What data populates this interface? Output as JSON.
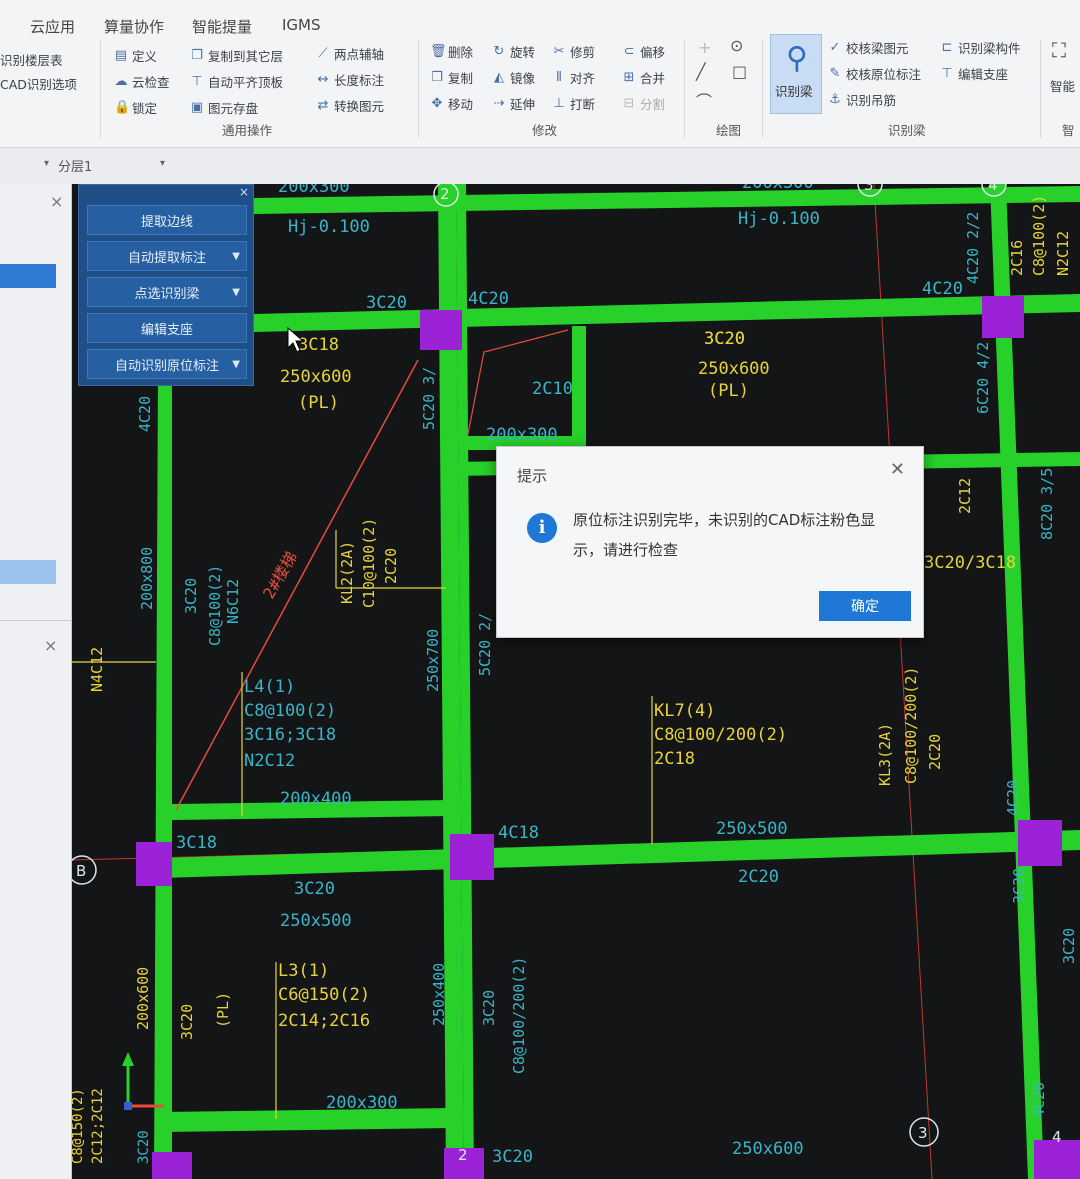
{
  "ribbon": {
    "tabs": [
      "云应用",
      "算量协作",
      "智能提量",
      "IGMS"
    ],
    "left_items": [
      "识别楼层表",
      "CAD识别选项"
    ],
    "general_ops": {
      "col1": [
        "定义",
        "云检查",
        "锁定"
      ],
      "col2": [
        "复制到其它层",
        "自动平齐顶板",
        "图元存盘"
      ],
      "col3": [
        "两点辅轴",
        "长度标注",
        "转换图元"
      ],
      "label": "通用操作"
    },
    "modify": {
      "col1": [
        "删除",
        "复制",
        "移动"
      ],
      "col2": [
        "旋转",
        "镜像",
        "延伸"
      ],
      "col3": [
        "修剪",
        "对齐",
        "打断"
      ],
      "col4": [
        "偏移",
        "合并",
        "分割"
      ],
      "label": "修改"
    },
    "draw_label": "绘图",
    "identify_beam": {
      "big_button": "识别梁",
      "items": [
        "校核梁图元",
        "校核原位标注",
        "识别吊筋",
        "识别梁构件",
        "编辑支座"
      ],
      "label": "识别梁"
    },
    "right_partial": [
      "智能",
      "智"
    ]
  },
  "subbar": {
    "layer": "分层1"
  },
  "toolpanel": {
    "buttons": [
      "提取边线",
      "自动提取标注",
      "点选识别梁",
      "编辑支座",
      "自动识别原位标注"
    ]
  },
  "dialog": {
    "title": "提示",
    "message": "原位标注识别完毕，未识别的CAD标注粉色显示，请进行检查",
    "ok": "确定"
  },
  "cad": {
    "axis_labels": [
      "2",
      "3",
      "4",
      "B",
      "2",
      "3",
      "4"
    ],
    "annotations": [
      "200x300",
      "Hj-0.100",
      "Hj-0.100",
      "200x300",
      "3C20",
      "4C20",
      "3C20",
      "4C20",
      "3C18",
      "250x600",
      "(PL)",
      "3C20",
      "250x600",
      "(PL)",
      "2C10",
      "200x300",
      "4C20",
      "200x800",
      "3C20",
      "C8@100(2)",
      "N6C12",
      "2#楼梯",
      "KL2(2A)",
      "C10@100(2)",
      "2C20",
      "250x700",
      "5C20 3/",
      "5C20 2/",
      "L4(1)",
      "C8@100(2)",
      "3C16;3C18",
      "N2C12",
      "200x400",
      "3C18",
      "4C18",
      "KL7(4)",
      "C8@100/200(2)",
      "2C18",
      "250x500",
      "2C20",
      "KL3(2A)",
      "C8@100/200(2)",
      "2C20",
      "4C20",
      "3C20",
      "3C20/3C18",
      "2C12",
      "6C20 4/2",
      "8C20 3/5",
      "4C20 2/2",
      "2C16",
      "C8@100(2)",
      "N2C12",
      "3C20",
      "250x500",
      "L3(1)",
      "C6@150(2)",
      "2C14;2C16",
      "(PL)",
      "200x600",
      "3C20",
      "250x400",
      "3C20",
      "C8@100/200(2)",
      "200x300",
      "N4C12",
      "C8@150(2)",
      "2C12;2C12",
      "3C20",
      "3C20",
      "250x600",
      "4C20",
      "3C20"
    ]
  }
}
